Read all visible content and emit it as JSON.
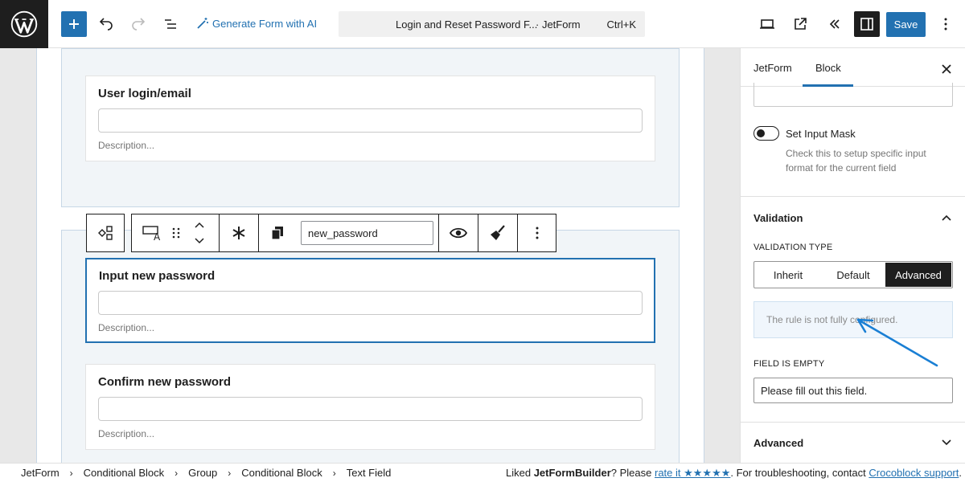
{
  "toolbar": {
    "generate_ai_label": "Generate Form with AI",
    "document_title": "Login and Reset Password F...",
    "document_type": "· JetForm",
    "shortcut": "Ctrl+K",
    "save_label": "Save"
  },
  "canvas": {
    "fields": [
      {
        "label": "User login/email",
        "description": "Description..."
      },
      {
        "label": "Input new password",
        "description": "Description..."
      },
      {
        "label": "Confirm new password",
        "description": "Description..."
      }
    ],
    "block_toolbar": {
      "field_name_value": "new_password"
    }
  },
  "sidebar": {
    "tabs": [
      "JetForm",
      "Block"
    ],
    "active_tab": "Block",
    "input_mask": {
      "label": "Set Input Mask",
      "help": "Check this to setup specific input format for the current field",
      "enabled": false
    },
    "validation": {
      "title": "Validation",
      "type_label": "VALIDATION TYPE",
      "options": [
        "Inherit",
        "Default",
        "Advanced"
      ],
      "selected": "Advanced",
      "notice": "The rule is not fully configured.",
      "empty_label": "FIELD IS EMPTY",
      "empty_value": "Please fill out this field."
    },
    "advanced_title": "Advanced"
  },
  "footer": {
    "breadcrumbs": [
      "JetForm",
      "Conditional Block",
      "Group",
      "Conditional Block",
      "Text Field"
    ],
    "msg_prefix": "Liked ",
    "msg_brand": "JetFormBuilder",
    "msg_mid": "? Please ",
    "rate_link": "rate it ★★★★★",
    "msg_after_rate": ". For troubleshooting, contact ",
    "support_link": "Crocoblock support",
    "msg_end": "."
  },
  "colors": {
    "accent": "#2271b1",
    "dark": "#1e1e1e",
    "condition_bg": "#f1f5f8",
    "notice_bg": "#f0f6fc"
  }
}
